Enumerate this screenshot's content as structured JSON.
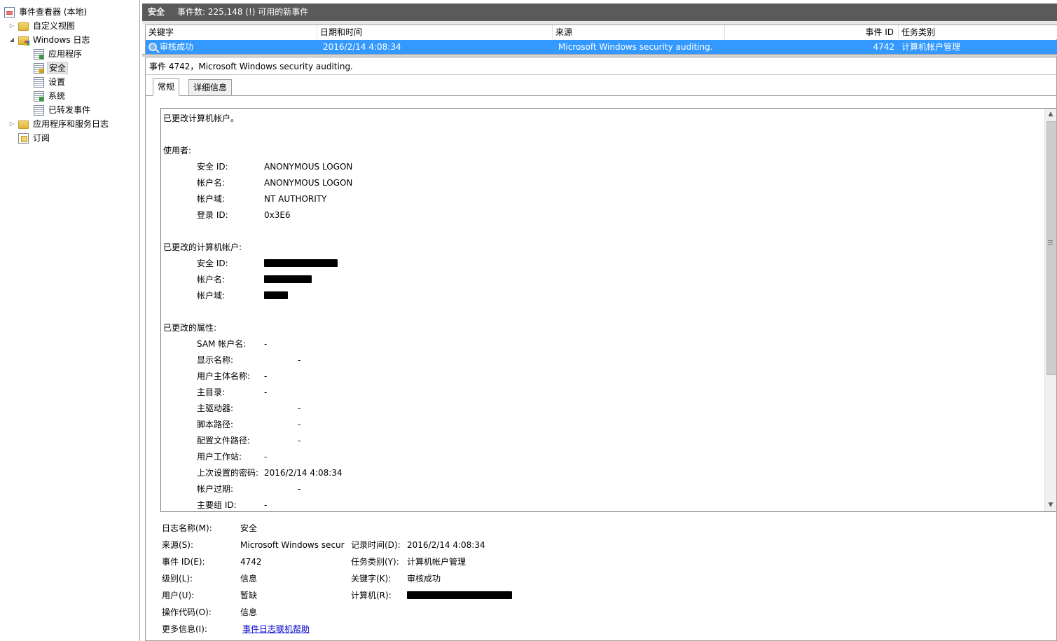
{
  "tree": {
    "root": "事件查看器 (本地)",
    "custom_views": "自定义视图",
    "windows_logs": "Windows 日志",
    "logs": [
      "应用程序",
      "安全",
      "设置",
      "系统",
      "已转发事件"
    ],
    "app_service_logs": "应用程序和服务日志",
    "subscriptions": "订阅"
  },
  "header": {
    "title": "安全",
    "count_text": "事件数: 225,148 (!) 可用的新事件"
  },
  "table": {
    "columns": [
      "关键字",
      "日期和时间",
      "来源",
      "事件 ID",
      "任务类别"
    ],
    "rows": [
      [
        "审核成功",
        "2016/2/14 4:08:34",
        "Microsoft Windows security auditing.",
        "4742",
        "计算机帐户管理"
      ]
    ]
  },
  "detail": {
    "title": "事件 4742，Microsoft Windows security auditing.",
    "tabs": [
      "常规",
      "详细信息"
    ],
    "message": {
      "heading": "已更改计算机帐户。",
      "subject_label": "使用者:",
      "subject": [
        {
          "k": "安全 ID:",
          "v": "ANONYMOUS LOGON"
        },
        {
          "k": "帐户名:",
          "v": "ANONYMOUS LOGON"
        },
        {
          "k": "帐户域:",
          "v": "NT AUTHORITY"
        },
        {
          "k": "登录 ID:",
          "v": "0x3E6"
        }
      ],
      "changed_account_label": "已更改的计算机帐户:",
      "changed_account": [
        {
          "k": "安全 ID:",
          "redacted": true
        },
        {
          "k": "帐户名:",
          "redacted": true
        },
        {
          "k": "帐户域:",
          "redacted": true
        }
      ],
      "attributes_label": "已更改的属性:",
      "attributes": [
        {
          "k": "SAM 帐户名:",
          "v": "-",
          "indent": "short"
        },
        {
          "k": "显示名称:",
          "v": "-",
          "indent": "long"
        },
        {
          "k": "用户主体名称:",
          "v": "-",
          "indent": "short"
        },
        {
          "k": "主目录:",
          "v": "-",
          "indent": "short"
        },
        {
          "k": "主驱动器:",
          "v": "-",
          "indent": "long"
        },
        {
          "k": "脚本路径:",
          "v": "-",
          "indent": "long"
        },
        {
          "k": "配置文件路径:",
          "v": "-",
          "indent": "long"
        },
        {
          "k": "用户工作站:",
          "v": "-",
          "indent": "short"
        },
        {
          "k": "上次设置的密码:",
          "v": "2016/2/14 4:08:34",
          "indent": "short"
        },
        {
          "k": "帐户过期:",
          "v": "-",
          "indent": "long"
        },
        {
          "k": "主要组 ID:",
          "v": "-",
          "indent": "short"
        }
      ]
    },
    "props": {
      "log_name_label": "日志名称(M):",
      "log_name": "安全",
      "source_label": "来源(S):",
      "source": "Microsoft Windows secur",
      "logged_label": "记录时间(D):",
      "logged": "2016/2/14 4:08:34",
      "event_id_label": "事件 ID(E):",
      "event_id": "4742",
      "task_label": "任务类别(Y):",
      "task": "计算机帐户管理",
      "level_label": "级别(L):",
      "level": "信息",
      "keywords_label": "关键字(K):",
      "keywords": "审核成功",
      "user_label": "用户(U):",
      "user": "暂缺",
      "computer_label": "计算机(R):",
      "opcode_label": "操作代码(O):",
      "opcode": "信息",
      "more_info_label": "更多信息(I):",
      "more_info_link": "事件日志联机帮助"
    }
  },
  "colors": {
    "header_bg": "#5a5a5a",
    "selection": "#3399ff",
    "link": "#0000cc"
  }
}
